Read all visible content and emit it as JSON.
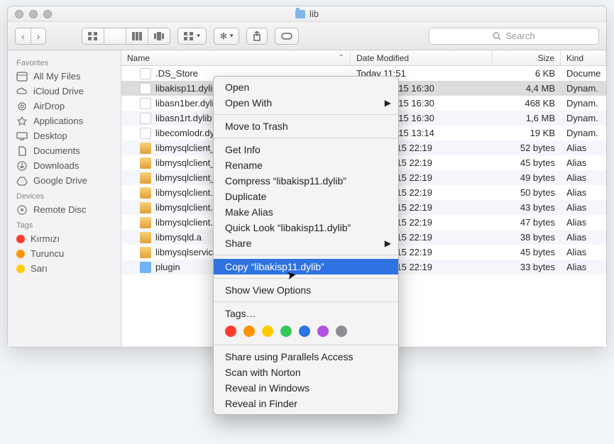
{
  "window": {
    "title": "lib"
  },
  "search": {
    "placeholder": "Search"
  },
  "sidebar": {
    "favorites_header": "Favorites",
    "devices_header": "Devices",
    "tags_header": "Tags",
    "favorites": [
      {
        "label": "All My Files",
        "icon": "all-files-icon"
      },
      {
        "label": "iCloud Drive",
        "icon": "cloud-icon"
      },
      {
        "label": "AirDrop",
        "icon": "airdrop-icon"
      },
      {
        "label": "Applications",
        "icon": "apps-icon"
      },
      {
        "label": "Desktop",
        "icon": "desktop-icon"
      },
      {
        "label": "Documents",
        "icon": "documents-icon"
      },
      {
        "label": "Downloads",
        "icon": "downloads-icon"
      },
      {
        "label": "Google Drive",
        "icon": "gdrive-icon"
      }
    ],
    "devices": [
      {
        "label": "Remote Disc",
        "icon": "disc-icon"
      }
    ],
    "tags": [
      {
        "label": "Kırmızı",
        "color": "#ff3b30"
      },
      {
        "label": "Turuncu",
        "color": "#ff9500"
      },
      {
        "label": "Sarı",
        "color": "#ffcc00"
      }
    ]
  },
  "columns": {
    "name": "Name",
    "date": "Date Modified",
    "size": "Size",
    "kind": "Kind"
  },
  "rows": [
    {
      "name": ".DS_Store",
      "date": "Today 11:51",
      "size": "6 KB",
      "kind": "Docume",
      "type": "file"
    },
    {
      "name": "libakisp11.dylib",
      "date": "19 Nov 2015 16:30",
      "size": "4,4 MB",
      "kind": "Dynam.",
      "type": "dylib",
      "selected": true
    },
    {
      "name": "libasn1ber.dylib",
      "date": "19 Nov 2015 16:30",
      "size": "468 KB",
      "kind": "Dynam.",
      "type": "dylib"
    },
    {
      "name": "libasn1rt.dylib",
      "date": "19 Nov 2015 16:30",
      "size": "1,6 MB",
      "kind": "Dynam.",
      "type": "dylib"
    },
    {
      "name": "libecomlodr.dylib",
      "date": "19 Nov 2015 13:14",
      "size": "19 KB",
      "kind": "Dynam.",
      "type": "dylib"
    },
    {
      "name": "libmysqlclient_r.18.dylib",
      "date": "12 Oct 2015 22:19",
      "size": "52 bytes",
      "kind": "Alias",
      "type": "alias"
    },
    {
      "name": "libmysqlclient_r.a",
      "date": "12 Oct 2015 22:19",
      "size": "45 bytes",
      "kind": "Alias",
      "type": "alias"
    },
    {
      "name": "libmysqlclient_r.dylib",
      "date": "12 Oct 2015 22:19",
      "size": "49 bytes",
      "kind": "Alias",
      "type": "alias"
    },
    {
      "name": "libmysqlclient.18.dylib",
      "date": "12 Oct 2015 22:19",
      "size": "50 bytes",
      "kind": "Alias",
      "type": "alias"
    },
    {
      "name": "libmysqlclient.a",
      "date": "12 Oct 2015 22:19",
      "size": "43 bytes",
      "kind": "Alias",
      "type": "alias"
    },
    {
      "name": "libmysqlclient.dylib",
      "date": "12 Oct 2015 22:19",
      "size": "47 bytes",
      "kind": "Alias",
      "type": "alias"
    },
    {
      "name": "libmysqld.a",
      "date": "12 Oct 2015 22:19",
      "size": "38 bytes",
      "kind": "Alias",
      "type": "alias"
    },
    {
      "name": "libmysqlservices.a",
      "date": "12 Oct 2015 22:19",
      "size": "45 bytes",
      "kind": "Alias",
      "type": "alias"
    },
    {
      "name": "plugin",
      "date": "12 Oct 2015 22:19",
      "size": "33 bytes",
      "kind": "Alias",
      "type": "folder"
    }
  ],
  "context_menu": {
    "open": "Open",
    "open_with": "Open With",
    "move_to_trash": "Move to Trash",
    "get_info": "Get Info",
    "rename": "Rename",
    "compress": "Compress “libakisp11.dylib”",
    "duplicate": "Duplicate",
    "make_alias": "Make Alias",
    "quick_look": "Quick Look “libakisp11.dylib”",
    "share": "Share",
    "copy": "Copy “libakisp11.dylib”",
    "show_view_options": "Show View Options",
    "tags": "Tags…",
    "tag_colors": [
      "#ff3b30",
      "#ff9500",
      "#ffcc00",
      "#34c759",
      "#2f72e2",
      "#af52de",
      "#8e8e93"
    ],
    "share_parallels": "Share using Parallels Access",
    "scan_norton": "Scan with Norton",
    "reveal_windows": "Reveal in Windows",
    "reveal_finder": "Reveal in Finder"
  }
}
